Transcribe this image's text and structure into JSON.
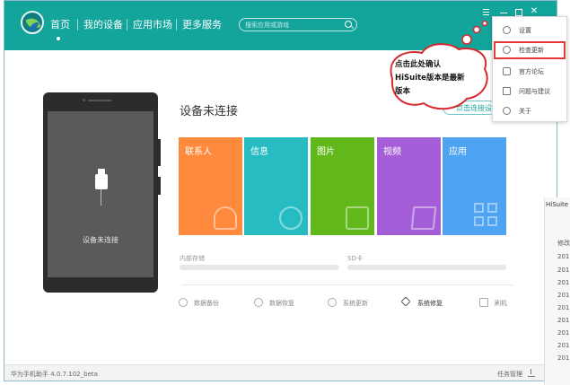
{
  "app": {
    "nav": [
      "首页",
      "我的设备",
      "应用市场",
      "更多服务"
    ],
    "search_placeholder": "搜索应用或游戏",
    "window_buttons": [
      "menu-icon",
      "minimize-icon",
      "maximize-icon",
      "close-icon"
    ]
  },
  "phone": {
    "status": "设备未连接"
  },
  "main": {
    "title": "设备未连接",
    "connect_button": "点击连接设备",
    "tiles": [
      {
        "label": "联系人",
        "color": "#ff8a3d",
        "icon": "contacts-icon"
      },
      {
        "label": "信息",
        "color": "#26bcc2",
        "icon": "messages-icon"
      },
      {
        "label": "图片",
        "color": "#62b81a",
        "icon": "photos-icon"
      },
      {
        "label": "视频",
        "color": "#a45fd8",
        "icon": "videos-icon"
      },
      {
        "label": "应用",
        "color": "#4ea3f2",
        "icon": "apps-icon"
      }
    ],
    "storage": {
      "internal": "内部存储",
      "sd": "SD卡"
    },
    "tools": [
      "数据备份",
      "数据恢复",
      "系统更新",
      "系统修复",
      "刷机"
    ]
  },
  "menu": {
    "items": [
      {
        "label": "设置",
        "icon": "gear-icon"
      },
      {
        "label": "检查更新",
        "icon": "refresh-icon"
      },
      {
        "label": "官方论坛",
        "icon": "forum-icon"
      },
      {
        "label": "问题与建议",
        "icon": "feedback-icon"
      },
      {
        "label": "关于",
        "icon": "info-icon"
      }
    ]
  },
  "callout": {
    "lines": [
      "点击此处确认",
      "HiSuite版本是最新",
      "版本"
    ]
  },
  "footer": {
    "version": "华为手机助手 4.0.7.102_beta",
    "task_manager": "任务管理"
  },
  "background_window": {
    "title": "HiSuite",
    "column": "修改",
    "rows": [
      "201",
      "201",
      "201",
      "201",
      "201",
      "201",
      "201",
      "201",
      "201"
    ]
  },
  "colors": {
    "accent": "#13a49b",
    "highlight": "#e53935"
  }
}
